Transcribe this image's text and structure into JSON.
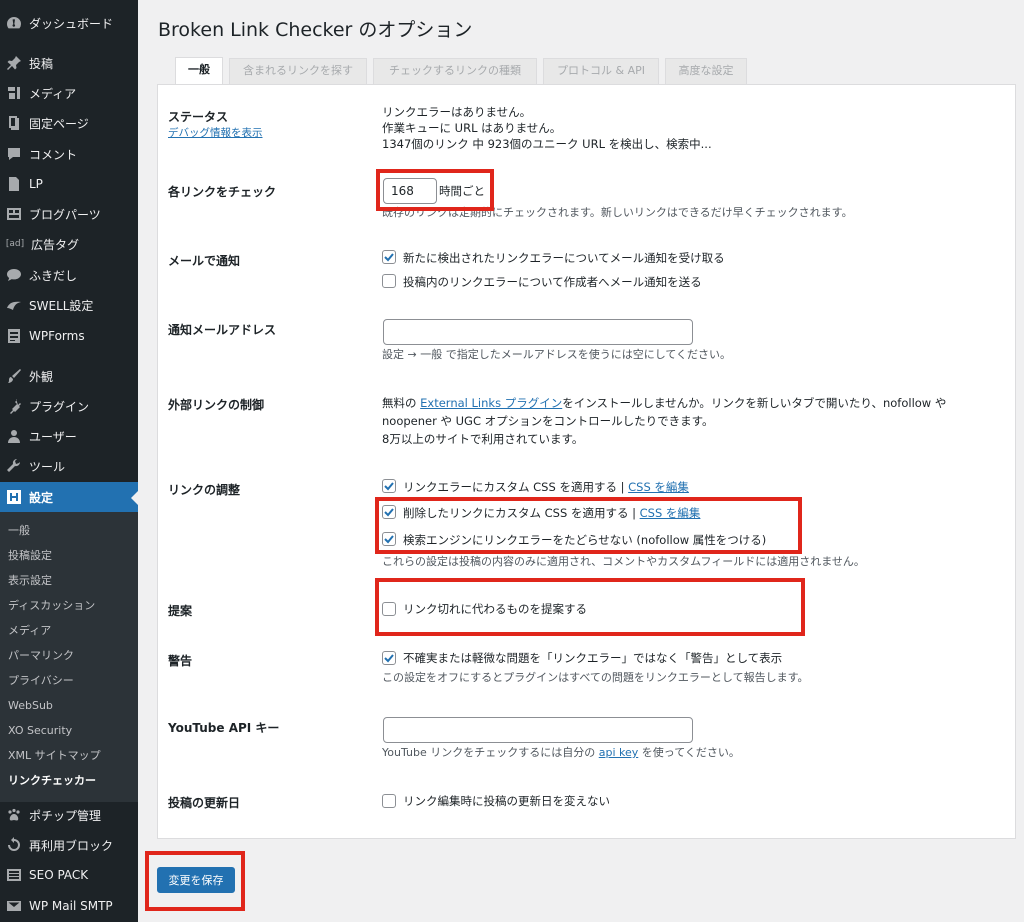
{
  "sidebar": {
    "items": [
      {
        "label": "ダッシュボード",
        "icon": "dashboard-icon"
      },
      {
        "label": "投稿",
        "icon": "pin-icon"
      },
      {
        "label": "メディア",
        "icon": "media-icon"
      },
      {
        "label": "固定ページ",
        "icon": "page-icon"
      },
      {
        "label": "コメント",
        "icon": "comment-icon"
      },
      {
        "label": "LP",
        "icon": "document-icon"
      },
      {
        "label": "ブログパーツ",
        "icon": "blog-parts-icon"
      },
      {
        "label": "広告タグ",
        "icon": "ad-icon",
        "glyph": "[ad]"
      },
      {
        "label": "ふきだし",
        "icon": "speech-bubble-icon"
      },
      {
        "label": "SWELL設定",
        "icon": "swell-icon"
      },
      {
        "label": "WPForms",
        "icon": "forms-icon"
      },
      {
        "label": "外観",
        "icon": "brush-icon"
      },
      {
        "label": "プラグイン",
        "icon": "plugin-icon"
      },
      {
        "label": "ユーザー",
        "icon": "user-icon"
      },
      {
        "label": "ツール",
        "icon": "wrench-icon"
      },
      {
        "label": "設定",
        "icon": "settings-icon",
        "active": true
      },
      {
        "label": "ポチップ管理",
        "icon": "paw-icon"
      },
      {
        "label": "再利用ブロック",
        "icon": "reuse-icon"
      },
      {
        "label": "SEO PACK",
        "icon": "seo-icon"
      },
      {
        "label": "WP Mail SMTP",
        "icon": "mail-icon"
      }
    ],
    "submenu": [
      "一般",
      "投稿設定",
      "表示設定",
      "ディスカッション",
      "メディア",
      "パーマリンク",
      "プライバシー",
      "WebSub",
      "XO Security",
      "XML サイトマップ",
      "リンクチェッカー"
    ],
    "submenu_current": "リンクチェッカー"
  },
  "page": {
    "title": "Broken Link Checker のオプション",
    "tabs": [
      "一般",
      "含まれるリンクを探す",
      "チェックするリンクの種類",
      "プロトコル & API",
      "高度な設定"
    ]
  },
  "settings": {
    "status": {
      "label": "ステータス",
      "debug_link": "デバッグ情報を表示",
      "line1": "リンクエラーはありません。",
      "line2": "作業キューに URL はありません。",
      "line3": "1347個のリンク 中 923個のユニーク URL を検出し、検索中..."
    },
    "check_each": {
      "label": "各リンクをチェック",
      "value": "168",
      "unit": "時間ごと",
      "desc": "既存のリンクは定期的にチェックされます。新しいリンクはできるだけ早くチェックされます。"
    },
    "email_notify": {
      "label": "メールで通知",
      "opt1": "新たに検出されたリンクエラーについてメール通知を受け取る",
      "opt2": "投稿内のリンクエラーについて作成者へメール通知を送る"
    },
    "notify_address": {
      "label": "通知メールアドレス",
      "value": "",
      "desc": "設定 → 一般 で指定したメールアドレスを使うには空にしてください。"
    },
    "external": {
      "label": "外部リンクの制御",
      "pre": "無料の ",
      "link": "External Links プラグイン",
      "post": "をインストールしませんか。リンクを新しいタブで開いたり、nofollow や",
      "line2": "noopener や UGC オプションをコントロールしたりできます。",
      "line3": "8万以上のサイトで利用されています。"
    },
    "link_tweaks": {
      "label": "リンクの調整",
      "opt1": "リンクエラーにカスタム CSS を適用する | ",
      "opt2": "削除したリンクにカスタム CSS を適用する | ",
      "css_link": "CSS を編集",
      "opt3": "検索エンジンにリンクエラーをたどらせない (nofollow 属性をつける)",
      "desc": "これらの設定は投稿の内容のみに適用され、コメントやカスタムフィールドには適用されません。"
    },
    "suggest": {
      "label": "提案",
      "opt": "リンク切れに代わるものを提案する"
    },
    "warning": {
      "label": "警告",
      "opt": "不確実または軽微な問題を「リンクエラー」ではなく「警告」として表示",
      "desc": "この設定をオフにするとプラグインはすべての問題をリンクエラーとして報告します。"
    },
    "youtube": {
      "label": "YouTube API キー",
      "value": "",
      "desc_pre": "YouTube リンクをチェックするには自分の ",
      "desc_link": "api key",
      "desc_post": " を使ってください。"
    },
    "post_update": {
      "label": "投稿の更新日",
      "opt": "リンク編集時に投稿の更新日を変えない"
    }
  },
  "save_label": "変更を保存",
  "colors": {
    "accent": "#2271b1",
    "highlight": "#e0261b",
    "sidebar": "#1d2327"
  }
}
